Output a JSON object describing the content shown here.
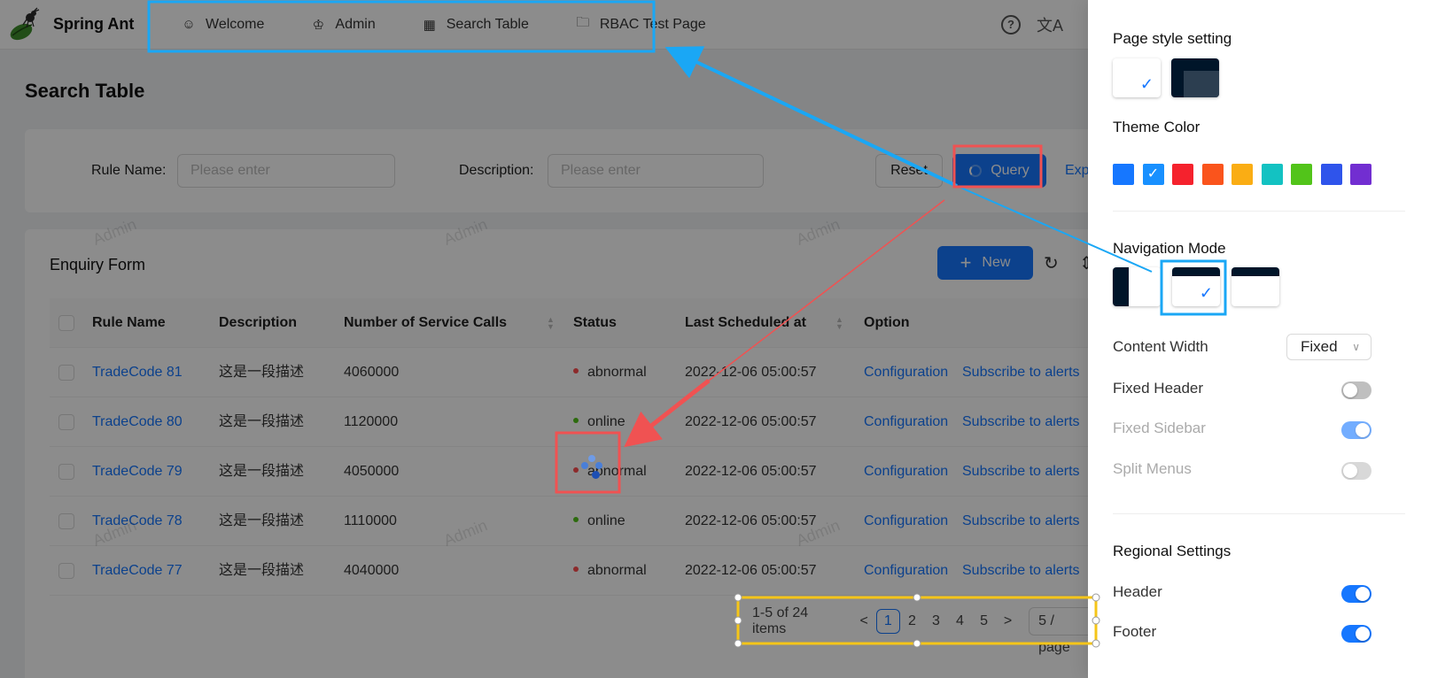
{
  "app": {
    "title": "Spring Ant",
    "nav": [
      {
        "icon": "smile-icon",
        "label": "Welcome"
      },
      {
        "icon": "crown-icon",
        "label": "Admin"
      },
      {
        "icon": "table-icon",
        "label": "Search Table"
      },
      {
        "icon": "folder-icon",
        "label": "RBAC Test Page"
      }
    ],
    "help_icon": "?",
    "translate_icon": "文A"
  },
  "page": {
    "title": "Search Table"
  },
  "search": {
    "rule_name_label": "Rule Name",
    "rule_name_placeholder": "Please enter",
    "description_label": "Description",
    "description_placeholder": "Please enter",
    "reset_label": "Reset",
    "query_label": "Query",
    "expand_label": "Expand"
  },
  "table": {
    "title": "Enquiry Form",
    "new_label": "New",
    "columns": [
      "Rule Name",
      "Description",
      "Number of Service Calls",
      "Status",
      "Last Scheduled at",
      "Option"
    ],
    "rows": [
      {
        "name": "TradeCode 81",
        "desc": "这是一段描述",
        "calls": "4060000",
        "status": "abnormal",
        "time": "2022-12-06 05:00:57",
        "opt1": "Configuration",
        "opt2": "Subscribe to alerts"
      },
      {
        "name": "TradeCode 80",
        "desc": "这是一段描述",
        "calls": "1120000",
        "status": "online",
        "time": "2022-12-06 05:00:57",
        "opt1": "Configuration",
        "opt2": "Subscribe to alerts"
      },
      {
        "name": "TradeCode 79",
        "desc": "这是一段描述",
        "calls": "4050000",
        "status": "abnormal",
        "time": "2022-12-06 05:00:57",
        "opt1": "Configuration",
        "opt2": "Subscribe to alerts"
      },
      {
        "name": "TradeCode 78",
        "desc": "这是一段描述",
        "calls": "1110000",
        "status": "online",
        "time": "2022-12-06 05:00:57",
        "opt1": "Configuration",
        "opt2": "Subscribe to alerts"
      },
      {
        "name": "TradeCode 77",
        "desc": "这是一段描述",
        "calls": "4040000",
        "status": "abnormal",
        "time": "2022-12-06 05:00:57",
        "opt1": "Configuration",
        "opt2": "Subscribe to alerts"
      }
    ],
    "status_colors": {
      "abnormal": "#ff4d4f",
      "online": "#52c41a"
    }
  },
  "pagination": {
    "total_text": "1-5 of 24 items",
    "pages": [
      "1",
      "2",
      "3",
      "4",
      "5"
    ],
    "current": "1",
    "prev": "<",
    "next": ">",
    "page_size": "5 / page"
  },
  "watermark": "Admin",
  "settings": {
    "page_style_title": "Page style setting",
    "theme_color_title": "Theme Color",
    "theme_colors": [
      "#1677ff",
      "#1890ff",
      "#f5222d",
      "#fa541c",
      "#faad14",
      "#13c2c2",
      "#52c41a",
      "#2f54eb",
      "#722ed1"
    ],
    "selected_theme_index": 1,
    "nav_mode_title": "Navigation Mode",
    "content_width_label": "Content Width",
    "content_width_value": "Fixed",
    "fixed_header_label": "Fixed Header",
    "fixed_header": false,
    "fixed_sidebar_label": "Fixed Sidebar",
    "fixed_sidebar": true,
    "split_menus_label": "Split Menus",
    "split_menus": false,
    "regional_title": "Regional Settings",
    "header_label": "Header",
    "header": true,
    "footer_label": "Footer",
    "footer": true,
    "check_mark": "✓"
  },
  "colors": {
    "primary": "#1677ff",
    "annotation_blue": "#1aa7f5",
    "annotation_red": "#f05252",
    "annotation_yellow": "#f5c518"
  }
}
